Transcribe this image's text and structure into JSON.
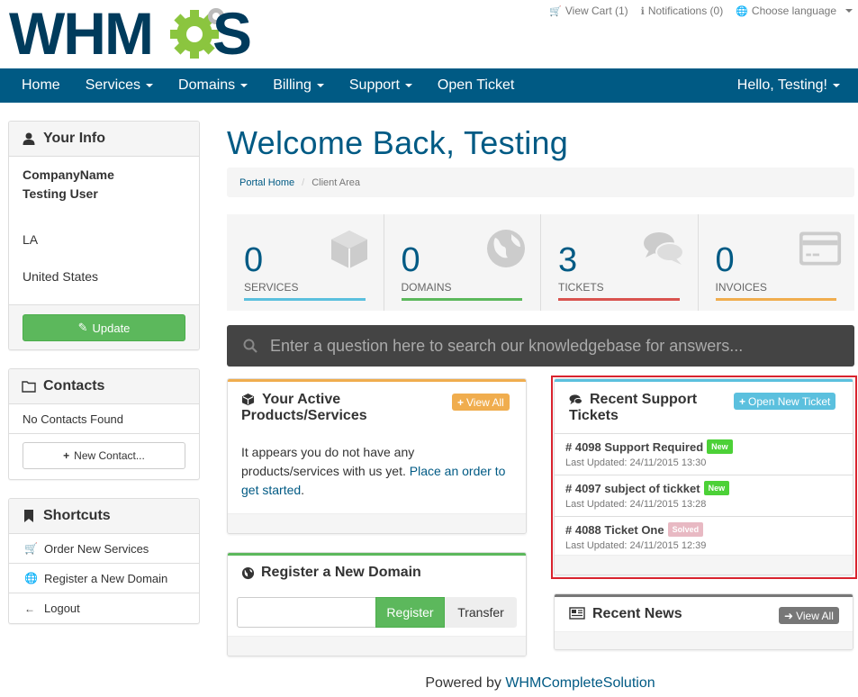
{
  "header": {
    "view_cart": "View Cart (1)",
    "notifications": "Notifications (0)",
    "language": "Choose language"
  },
  "nav": {
    "items": [
      "Home",
      "Services",
      "Domains",
      "Billing",
      "Support",
      "Open Ticket"
    ],
    "user": "Hello, Testing!"
  },
  "your_info": {
    "title": "Your Info",
    "company": "CompanyName",
    "name": "Testing User",
    "state": "LA",
    "country": "United States",
    "update_label": "Update"
  },
  "contacts": {
    "title": "Contacts",
    "empty": "No Contacts Found",
    "new_label": "New Contact..."
  },
  "shortcuts": {
    "title": "Shortcuts",
    "items": [
      "Order New Services",
      "Register a New Domain",
      "Logout"
    ]
  },
  "main": {
    "welcome": "Welcome Back, Testing",
    "breadcrumb_home": "Portal Home",
    "breadcrumb_current": "Client Area"
  },
  "tiles": [
    {
      "value": "0",
      "label": "SERVICES",
      "color": "#5bc0de"
    },
    {
      "value": "0",
      "label": "DOMAINS",
      "color": "#5cb85c"
    },
    {
      "value": "3",
      "label": "TICKETS",
      "color": "#d9534f"
    },
    {
      "value": "0",
      "label": "INVOICES",
      "color": "#f0ad4e"
    }
  ],
  "kb": {
    "placeholder": "Enter a question here to search our knowledgebase for answers..."
  },
  "products": {
    "title_line1": "Your Active",
    "title_line2": "Products/Services",
    "view_all": "View All",
    "body": "It appears you do not have any products/services with us yet.",
    "link": "Place an order to get started",
    "dot": "."
  },
  "domain_reg": {
    "title": "Register a New Domain",
    "register": "Register",
    "transfer": "Transfer"
  },
  "tickets": {
    "title_line1": "Recent Support",
    "title_line2": "Tickets",
    "open_new": "Open New Ticket",
    "items": [
      {
        "title": "# 4098 Support Required",
        "status": "New",
        "updated": "Last Updated: 24/11/2015 13:30"
      },
      {
        "title": "# 4097 subject of tickket",
        "status": "New",
        "updated": "Last Updated: 24/11/2015 13:28"
      },
      {
        "title": "# 4088 Ticket One",
        "status": "Solved",
        "updated": "Last Updated: 24/11/2015 12:39"
      }
    ]
  },
  "news": {
    "title": "Recent News",
    "view_all": "View All"
  },
  "footer": {
    "powered": "Powered by",
    "link": "WHMCompleteSolution"
  },
  "colors": {
    "brand": "#005a84",
    "success": "#5cb85c",
    "info": "#5bc0de",
    "warning": "#f0ad4e",
    "danger": "#d9534f",
    "logo_green": "#8bc53f"
  }
}
